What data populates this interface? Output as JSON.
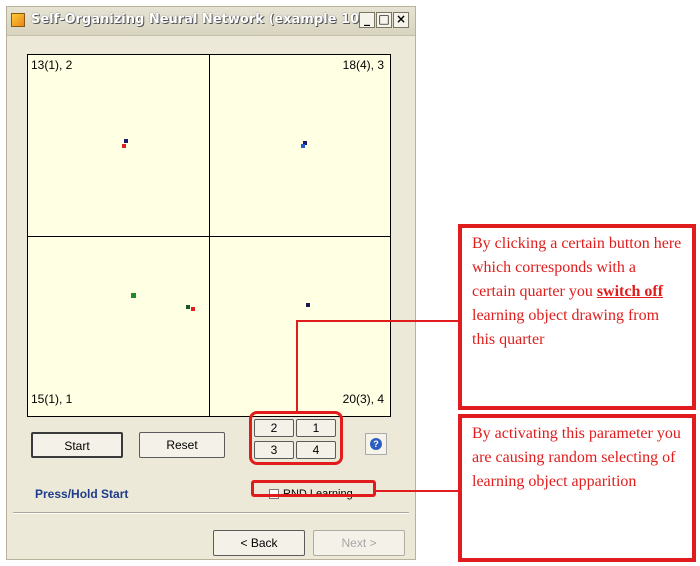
{
  "window": {
    "title": "Self-Organizing Neural Network (example 10b)",
    "controls": {
      "minimize": "_",
      "maximize": "□",
      "close": "×"
    }
  },
  "quarters": {
    "tl": "13(1), 2",
    "tr": "18(4), 3",
    "bl": "15(1), 1",
    "br": "20(3), 4"
  },
  "buttons": {
    "start": "Start",
    "reset": "Reset",
    "back": "< Back",
    "next": "Next >",
    "help": "?"
  },
  "quarter_buttons": [
    "2",
    "1",
    "3",
    "4"
  ],
  "status": "Press/Hold Start",
  "checkbox": {
    "label": "RND Learning",
    "checked": false
  },
  "annotations": {
    "switch_off_pre": "By clicking a certain button here which corresponds with a certain quarter you ",
    "switch_off_bold": "switch off",
    "switch_off_post": " learning object drawing from this quarter",
    "random": "By activating this parameter  you are causing random selecting of learning object apparition"
  },
  "colors": {
    "annotation": "#e01c1c",
    "status": "#1e3c8a",
    "grid_bg": "#ffffe4"
  }
}
